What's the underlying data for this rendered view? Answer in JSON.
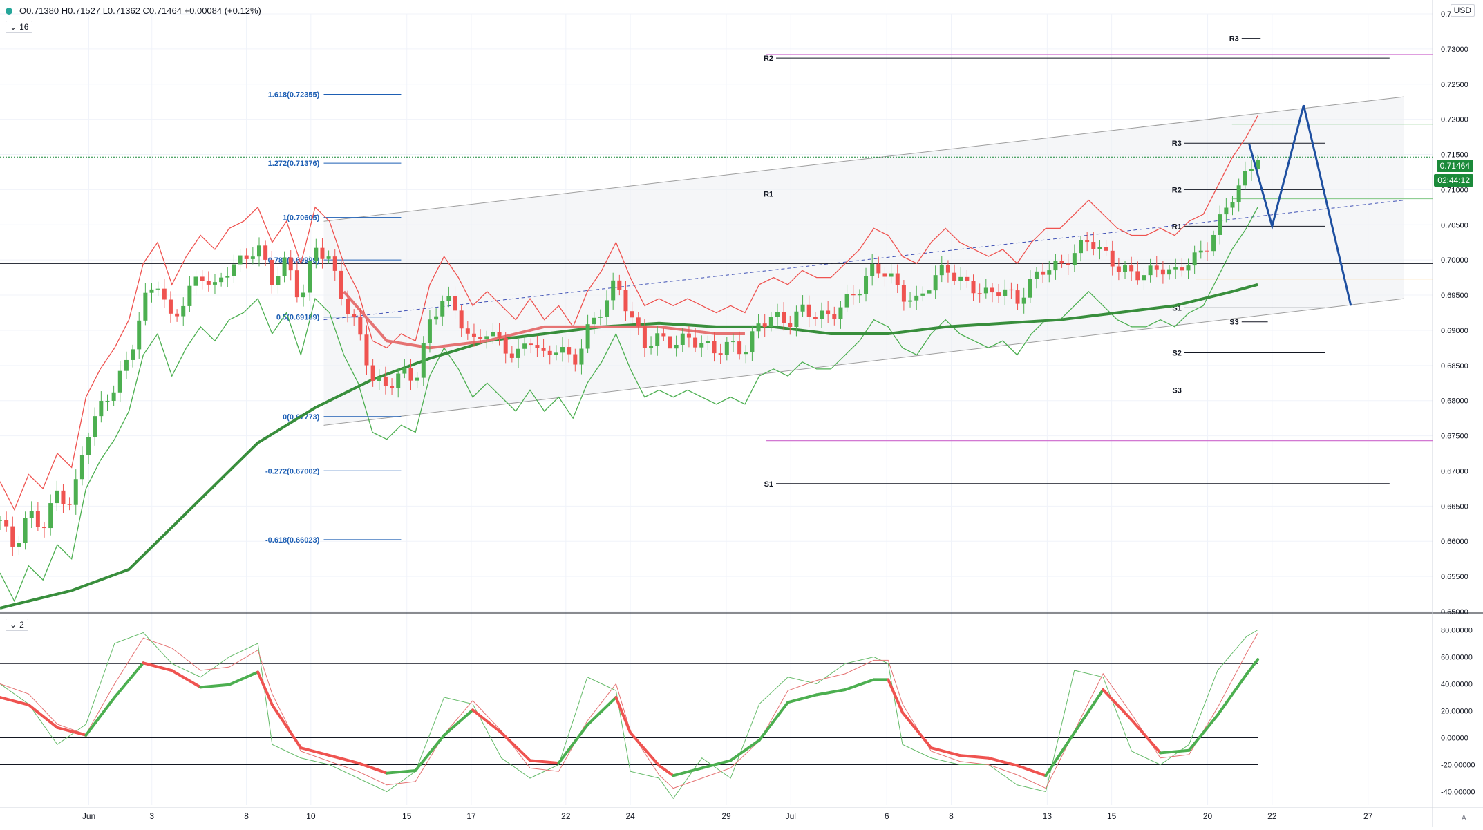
{
  "header": {
    "ohlc": "O0.71380  H0.71527  L0.71362  C0.71464  +0.00084 (+0.12%)",
    "main_badge": "16",
    "osc_badge": "2",
    "currency": "USD",
    "price_tag": "0.71464",
    "timer_tag": "02:44:12",
    "auto_label": "A"
  },
  "colors": {
    "bull": "#4caf50",
    "bear": "#ef5350",
    "ma_slow": "#388e3c",
    "ma_fast": "#e57373",
    "fib": "#1e5fb4",
    "pivot": "#131722",
    "channel": "#9e9e9e",
    "projection": "#1e4fa0"
  },
  "chart_data": [
    {
      "type": "candlestick",
      "ylim": [
        0.65,
        0.735
      ],
      "y_ticks": [
        "0.73500",
        "0.73000",
        "0.72500",
        "0.72000",
        "0.71500",
        "0.71000",
        "0.70500",
        "0.70000",
        "0.69500",
        "0.69000",
        "0.68500",
        "0.68000",
        "0.67500",
        "0.67000",
        "0.66500",
        "0.66000",
        "0.65500",
        "0.65000"
      ],
      "x_ticks": [
        {
          "label": "Jun",
          "x": 0.062
        },
        {
          "label": "3",
          "x": 0.106
        },
        {
          "label": "8",
          "x": 0.172
        },
        {
          "label": "10",
          "x": 0.217
        },
        {
          "label": "15",
          "x": 0.284
        },
        {
          "label": "17",
          "x": 0.329
        },
        {
          "label": "22",
          "x": 0.395
        },
        {
          "label": "24",
          "x": 0.44
        },
        {
          "label": "29",
          "x": 0.507
        },
        {
          "label": "Jul",
          "x": 0.552
        },
        {
          "label": "6",
          "x": 0.619
        },
        {
          "label": "8",
          "x": 0.664
        },
        {
          "label": "13",
          "x": 0.731
        },
        {
          "label": "15",
          "x": 0.776
        },
        {
          "label": "20",
          "x": 0.843
        },
        {
          "label": "22",
          "x": 0.888
        },
        {
          "label": "27",
          "x": 0.955
        }
      ],
      "close_path": [
        [
          0.0,
          0.663
        ],
        [
          0.01,
          0.659
        ],
        [
          0.02,
          0.664
        ],
        [
          0.03,
          0.662
        ],
        [
          0.04,
          0.667
        ],
        [
          0.05,
          0.665
        ],
        [
          0.06,
          0.675
        ],
        [
          0.07,
          0.679
        ],
        [
          0.08,
          0.682
        ],
        [
          0.09,
          0.686
        ],
        [
          0.1,
          0.694
        ],
        [
          0.11,
          0.697
        ],
        [
          0.12,
          0.691
        ],
        [
          0.13,
          0.695
        ],
        [
          0.14,
          0.698
        ],
        [
          0.15,
          0.696
        ],
        [
          0.16,
          0.699
        ],
        [
          0.17,
          0.7
        ],
        [
          0.18,
          0.702
        ],
        [
          0.19,
          0.697
        ],
        [
          0.2,
          0.7
        ],
        [
          0.21,
          0.694
        ],
        [
          0.22,
          0.702
        ],
        [
          0.23,
          0.7
        ],
        [
          0.24,
          0.694
        ],
        [
          0.25,
          0.69
        ],
        [
          0.26,
          0.683
        ],
        [
          0.27,
          0.682
        ],
        [
          0.28,
          0.684
        ],
        [
          0.29,
          0.683
        ],
        [
          0.3,
          0.691
        ],
        [
          0.31,
          0.695
        ],
        [
          0.32,
          0.692
        ],
        [
          0.33,
          0.688
        ],
        [
          0.34,
          0.69
        ],
        [
          0.35,
          0.688
        ],
        [
          0.36,
          0.686
        ],
        [
          0.37,
          0.689
        ],
        [
          0.38,
          0.686
        ],
        [
          0.39,
          0.688
        ],
        [
          0.4,
          0.685
        ],
        [
          0.41,
          0.69
        ],
        [
          0.42,
          0.693
        ],
        [
          0.43,
          0.697
        ],
        [
          0.44,
          0.692
        ],
        [
          0.45,
          0.688
        ],
        [
          0.46,
          0.689
        ],
        [
          0.47,
          0.688
        ],
        [
          0.48,
          0.689
        ],
        [
          0.49,
          0.688
        ],
        [
          0.5,
          0.687
        ],
        [
          0.51,
          0.688
        ],
        [
          0.52,
          0.687
        ],
        [
          0.53,
          0.691
        ],
        [
          0.54,
          0.692
        ],
        [
          0.55,
          0.691
        ],
        [
          0.56,
          0.693
        ],
        [
          0.57,
          0.692
        ],
        [
          0.58,
          0.692
        ],
        [
          0.59,
          0.694
        ],
        [
          0.6,
          0.696
        ],
        [
          0.61,
          0.699
        ],
        [
          0.62,
          0.698
        ],
        [
          0.63,
          0.695
        ],
        [
          0.64,
          0.694
        ],
        [
          0.65,
          0.697
        ],
        [
          0.66,
          0.699
        ],
        [
          0.67,
          0.697
        ],
        [
          0.68,
          0.696
        ],
        [
          0.69,
          0.695
        ],
        [
          0.7,
          0.696
        ],
        [
          0.71,
          0.694
        ],
        [
          0.72,
          0.697
        ],
        [
          0.73,
          0.699
        ],
        [
          0.74,
          0.699
        ],
        [
          0.75,
          0.701
        ],
        [
          0.76,
          0.703
        ],
        [
          0.77,
          0.701
        ],
        [
          0.78,
          0.699
        ],
        [
          0.79,
          0.698
        ],
        [
          0.8,
          0.698
        ],
        [
          0.81,
          0.699
        ],
        [
          0.82,
          0.698
        ],
        [
          0.83,
          0.7
        ],
        [
          0.84,
          0.701
        ],
        [
          0.85,
          0.705
        ],
        [
          0.86,
          0.709
        ],
        [
          0.87,
          0.712
        ],
        [
          0.878,
          0.715
        ]
      ],
      "series": [
        {
          "type": "ma",
          "points": [
            [
              0.0,
              0.6505
            ],
            [
              0.05,
              0.653
            ],
            [
              0.09,
              0.656
            ],
            [
              0.12,
              0.662
            ],
            [
              0.15,
              0.668
            ],
            [
              0.18,
              0.674
            ],
            [
              0.22,
              0.679
            ],
            [
              0.26,
              0.683
            ],
            [
              0.3,
              0.686
            ],
            [
              0.34,
              0.6885
            ],
            [
              0.38,
              0.6895
            ],
            [
              0.42,
              0.6905
            ],
            [
              0.46,
              0.691
            ],
            [
              0.5,
              0.6905
            ],
            [
              0.54,
              0.6905
            ],
            [
              0.58,
              0.6895
            ],
            [
              0.62,
              0.6895
            ],
            [
              0.66,
              0.6905
            ],
            [
              0.7,
              0.691
            ],
            [
              0.74,
              0.6915
            ],
            [
              0.78,
              0.6925
            ],
            [
              0.82,
              0.6935
            ],
            [
              0.86,
              0.6955
            ],
            [
              0.878,
              0.6965
            ]
          ]
        },
        {
          "type": "ma_fast",
          "points": [
            [
              0.24,
              0.6955
            ],
            [
              0.27,
              0.6885
            ],
            [
              0.3,
              0.6875
            ],
            [
              0.34,
              0.6885
            ],
            [
              0.38,
              0.6905
            ],
            [
              0.42,
              0.6905
            ],
            [
              0.46,
              0.6905
            ],
            [
              0.5,
              0.6895
            ],
            [
              0.52,
              0.6895
            ]
          ]
        }
      ],
      "fib_levels": [
        {
          "label": "1.618(0.72355)",
          "value": 0.72355
        },
        {
          "label": "1.272(0.71376)",
          "value": 0.71376
        },
        {
          "label": "1(0.70605)",
          "value": 0.70605
        },
        {
          "label": "0.786(0.69999)",
          "value": 0.7
        },
        {
          "label": "0.5(0.69189)",
          "value": 0.69189
        },
        {
          "label": "0(0.67773)",
          "value": 0.67773
        },
        {
          "label": "-0.272(0.67002)",
          "value": 0.67002
        },
        {
          "label": "-0.618(0.66023)",
          "value": 0.66023
        }
      ],
      "pivots": [
        {
          "label": "R3",
          "value": 0.7315,
          "x1": 0.86,
          "x2": 0.88
        },
        {
          "label": "R2",
          "value": 0.7287,
          "x1": 0.535,
          "x2": 0.97
        },
        {
          "label": "R1",
          "value": 0.7094,
          "x1": 0.535,
          "x2": 0.97
        },
        {
          "label": "S1",
          "value": 0.6682,
          "x1": 0.535,
          "x2": 0.97
        },
        {
          "label": "R3",
          "value": 0.7166,
          "x1": 0.82,
          "x2": 0.925
        },
        {
          "label": "R2",
          "value": 0.71,
          "x1": 0.82,
          "x2": 0.925
        },
        {
          "label": "R1",
          "value": 0.7048,
          "x1": 0.82,
          "x2": 0.925
        },
        {
          "label": "S1",
          "value": 0.6932,
          "x1": 0.82,
          "x2": 0.925
        },
        {
          "label": "S2",
          "value": 0.6868,
          "x1": 0.82,
          "x2": 0.925
        },
        {
          "label": "S3",
          "value": 0.6815,
          "x1": 0.82,
          "x2": 0.925
        },
        {
          "label": "S3",
          "value": 0.6912,
          "x1": 0.86,
          "x2": 0.885
        }
      ],
      "projection": [
        [
          0.872,
          0.7165
        ],
        [
          0.888,
          0.7048
        ],
        [
          0.91,
          0.722
        ],
        [
          0.943,
          0.6935
        ]
      ]
    },
    {
      "type": "line",
      "ylim": [
        -50,
        90
      ],
      "y_ticks": [
        "80.00000",
        "60.00000",
        "40.00000",
        "20.00000",
        "0.00000",
        "-20.00000",
        "-40.00000"
      ],
      "levels": [
        55,
        0,
        -20
      ],
      "series": [
        {
          "points": [
            [
              0.0,
              40
            ],
            [
              0.02,
              25
            ],
            [
              0.04,
              -5
            ],
            [
              0.06,
              10
            ],
            [
              0.08,
              70
            ],
            [
              0.1,
              78
            ],
            [
              0.12,
              55
            ],
            [
              0.14,
              45
            ],
            [
              0.16,
              60
            ],
            [
              0.18,
              70
            ],
            [
              0.19,
              -5
            ],
            [
              0.21,
              -15
            ],
            [
              0.23,
              -20
            ],
            [
              0.25,
              -30
            ],
            [
              0.27,
              -40
            ],
            [
              0.29,
              -25
            ],
            [
              0.31,
              30
            ],
            [
              0.33,
              25
            ],
            [
              0.35,
              -15
            ],
            [
              0.37,
              -30
            ],
            [
              0.39,
              -20
            ],
            [
              0.41,
              45
            ],
            [
              0.43,
              35
            ],
            [
              0.44,
              -25
            ],
            [
              0.46,
              -30
            ],
            [
              0.47,
              -45
            ],
            [
              0.49,
              -15
            ],
            [
              0.51,
              -30
            ],
            [
              0.53,
              25
            ],
            [
              0.55,
              45
            ],
            [
              0.57,
              40
            ],
            [
              0.59,
              55
            ],
            [
              0.61,
              60
            ],
            [
              0.62,
              55
            ],
            [
              0.63,
              -5
            ],
            [
              0.65,
              -15
            ],
            [
              0.67,
              -20
            ],
            [
              0.69,
              -20
            ],
            [
              0.71,
              -35
            ],
            [
              0.73,
              -40
            ],
            [
              0.75,
              50
            ],
            [
              0.77,
              45
            ],
            [
              0.79,
              -10
            ],
            [
              0.81,
              -20
            ],
            [
              0.83,
              -5
            ],
            [
              0.85,
              50
            ],
            [
              0.87,
              75
            ],
            [
              0.878,
              80
            ]
          ]
        }
      ]
    }
  ]
}
